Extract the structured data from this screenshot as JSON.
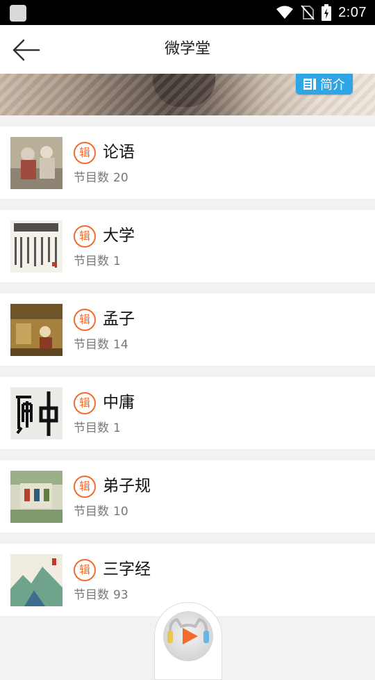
{
  "status_bar": {
    "time": "2:07"
  },
  "header": {
    "title": "微学堂"
  },
  "banner": {
    "intro_label": "简介"
  },
  "list": {
    "count_label": "节目数",
    "tag": "辑",
    "items": [
      {
        "name": "论语",
        "count": "20",
        "thumb": "painting-scholars"
      },
      {
        "name": "大学",
        "count": "1",
        "thumb": "calligraphy-scroll"
      },
      {
        "name": "孟子",
        "count": "14",
        "thumb": "painting-courtyard"
      },
      {
        "name": "中庸",
        "count": "1",
        "thumb": "calligraphy-characters"
      },
      {
        "name": "弟子规",
        "count": "10",
        "thumb": "painting-pavilion"
      },
      {
        "name": "三字经",
        "count": "93",
        "thumb": "painting-landscape"
      }
    ]
  },
  "player": {
    "icon": "play-icon"
  },
  "colors": {
    "accent": "#f26b2d",
    "badge_blue": "#2ea6e6"
  }
}
